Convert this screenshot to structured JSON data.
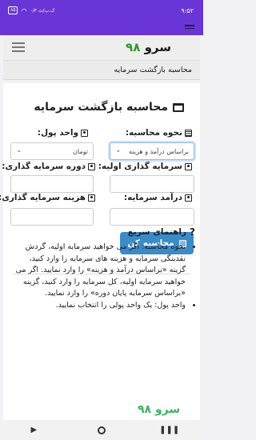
{
  "status": {
    "time": "۹:۵۲",
    "battery": "۸۵",
    "network": "۰/۳ ک.ب/ث"
  },
  "navbar": {
    "brand_text": "سرو",
    "brand_num": "۹۸"
  },
  "breadcrumb": {
    "text": "محاسبه بازگشت سرمایه"
  },
  "page": {
    "title": "محاسبه بازگشت سرمایه"
  },
  "form": {
    "calc_mode_label": "نحوه محاسبه:",
    "calc_mode_value": "براساس درآمد و هزینه",
    "currency_label": "واحد پول:",
    "currency_value": "تومان",
    "initial_investment_label": "سرمایه گذاری اولیه:",
    "investment_period_label": "دوره سرمایه گذاری:",
    "income_label": "درآمد سرمایه:",
    "cost_label": "هزینه سرمایه گذاری:",
    "submit_label": "محاسبه کن"
  },
  "guide": {
    "title": "راهنمای سریع",
    "items": [
      "نحوه محاسبه: اگر می خواهید سرمایه اولیه، گردش نقدینگی سرمایه و هزینه های سرمایه را وارد کنید، گزینه «براساس درآمد و هزینه» را وارد نمایید. اگر می خواهید سرمایه اولیه، کل سرمایه را وارد کنید، گزینه «براساس سرمایه پایان دوره» را وارد نمایید.",
      "واحد پول: یک واحد پولی را انتخاب نمایید."
    ]
  },
  "watermark": "سرو ۹۸",
  "icons": [
    "battery-icon",
    "wifi-icon",
    "menu-icon",
    "window-icon",
    "calculator-icon",
    "money-icon",
    "question-icon",
    "chevron-down-icon"
  ]
}
